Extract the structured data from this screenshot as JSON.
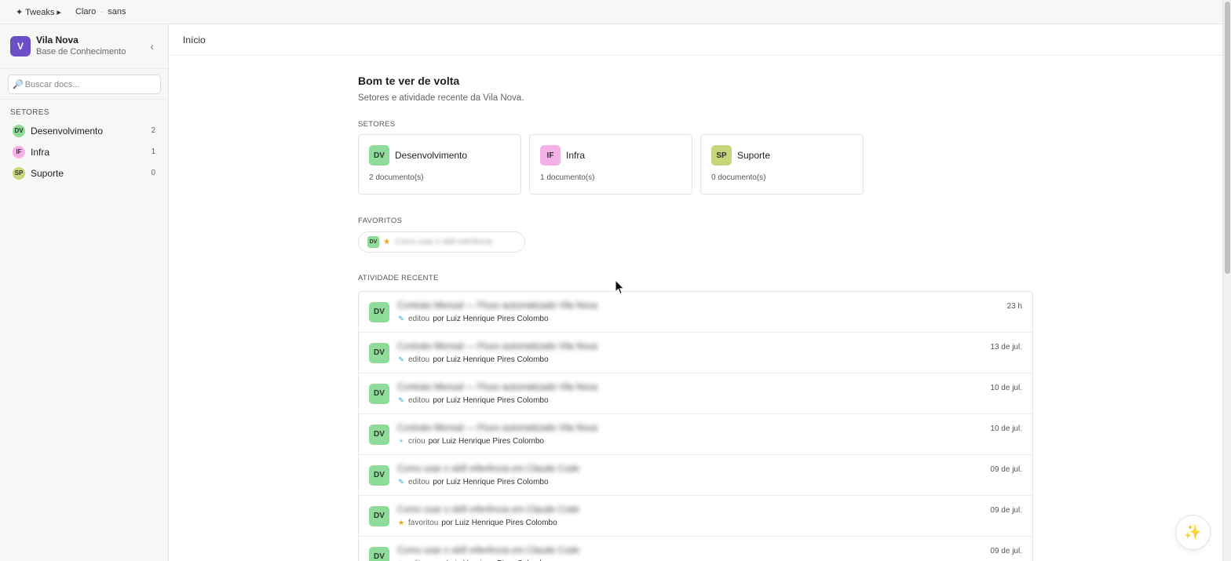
{
  "topbar": {
    "tweaks_label": "✦ Tweaks ▸",
    "theme": "Claro",
    "separator": "·",
    "font": "sans"
  },
  "sidebar": {
    "brand_initial": "V",
    "brand_name": "Vila Nova",
    "brand_sub": "Base de Conhecimento",
    "collapse_icon": "‹",
    "search_placeholder": "Buscar docs...",
    "section_title": "SETORES",
    "items": [
      {
        "badge": "DV",
        "label": "Desenvolvimento",
        "count": "2",
        "color": "#8fdc9a"
      },
      {
        "badge": "IF",
        "label": "Infra",
        "count": "1",
        "color": "#f5b0e6"
      },
      {
        "badge": "SP",
        "label": "Suporte",
        "count": "0",
        "color": "#c7d67a"
      }
    ]
  },
  "main": {
    "breadcrumb": "Início",
    "greeting": "Bom te ver de volta",
    "lead": "Setores e atividade recente da Vila Nova.",
    "sectors_label": "SETORES",
    "sectors": [
      {
        "badge": "DV",
        "name": "Desenvolvimento",
        "count": "2 documento(s)",
        "color": "#8fdc9a"
      },
      {
        "badge": "IF",
        "name": "Infra",
        "count": "1 documento(s)",
        "color": "#f5b0e6"
      },
      {
        "badge": "SP",
        "name": "Suporte",
        "count": "0 documento(s)",
        "color": "#c7d67a"
      }
    ],
    "favorites_label": "FAVORITOS",
    "favorite": {
      "badge": "DV",
      "star": "★",
      "title": "Como usar o skill referência"
    },
    "activity_label": "ATIVIDADE RECENTE",
    "activity": [
      {
        "badge": "DV",
        "title": "Contrato Mensal — Fluxo automatizado Vila Nova",
        "icon": "✎",
        "verb": "editou",
        "by": "por Luiz Henrique Pires Colombo",
        "time": "23 h"
      },
      {
        "badge": "DV",
        "title": "Contrato Mensal — Fluxo automatizado Vila Nova",
        "icon": "✎",
        "verb": "editou",
        "by": "por Luiz Henrique Pires Colombo",
        "time": "13 de jul."
      },
      {
        "badge": "DV",
        "title": "Contrato Mensal — Fluxo automatizado Vila Nova",
        "icon": "✎",
        "verb": "editou",
        "by": "por Luiz Henrique Pires Colombo",
        "time": "10 de jul."
      },
      {
        "badge": "DV",
        "title": "Contrato Mensal — Fluxo automatizado Vila Nova",
        "icon": "+",
        "verb": "criou",
        "by": "por Luiz Henrique Pires Colombo",
        "time": "10 de jul."
      },
      {
        "badge": "DV",
        "title": "Como usar o skill referência em Claude Code",
        "icon": "✎",
        "verb": "editou",
        "by": "por Luiz Henrique Pires Colombo",
        "time": "09 de jul."
      },
      {
        "badge": "DV",
        "title": "Como usar o skill referência em Claude Code",
        "icon": "★",
        "verb": "favoritou",
        "by": "por Luiz Henrique Pires Colombo",
        "time": "09 de jul."
      },
      {
        "badge": "DV",
        "title": "Como usar o skill referência em Claude Code",
        "icon": "✎",
        "verb": "editou",
        "by": "por Luiz Henrique Pires Colombo",
        "time": "09 de jul."
      }
    ],
    "dv_color": "#8fdc9a"
  },
  "fab_icon": "✨",
  "icons": {
    "search": "search-icon",
    "collapse": "chevron-left-icon",
    "fab": "sparkles-icon",
    "edit": "pencil-icon",
    "create": "plus-icon",
    "favorite": "star-icon"
  }
}
